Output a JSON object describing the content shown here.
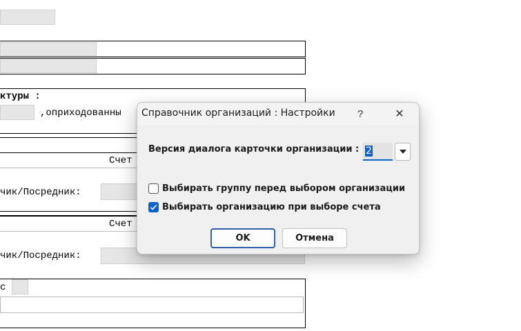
{
  "background_form": {
    "label_structure": "ктуры  :",
    "label_received": ",оприходованны",
    "label_account_1": "Счет",
    "label_intermediary_1": "чик/Посредник:",
    "label_account_2": "Счет",
    "label_intermediary_2": "чик/Посредник:",
    "label_c": "с"
  },
  "dialog": {
    "title": "Справочник организаций : Настройки",
    "help_glyph": "?",
    "close_glyph": "✕",
    "version_label": "Версия диалога карточки организации :",
    "version_value": "2",
    "checkbox_group": {
      "label": "Выбирать группу перед выбором организации",
      "checked": false
    },
    "checkbox_org": {
      "label": "Выбирать организацию при выборе счета",
      "checked": true
    },
    "ok_label": "OK",
    "cancel_label": "Отмена",
    "accent_color": "#0b63c9"
  }
}
